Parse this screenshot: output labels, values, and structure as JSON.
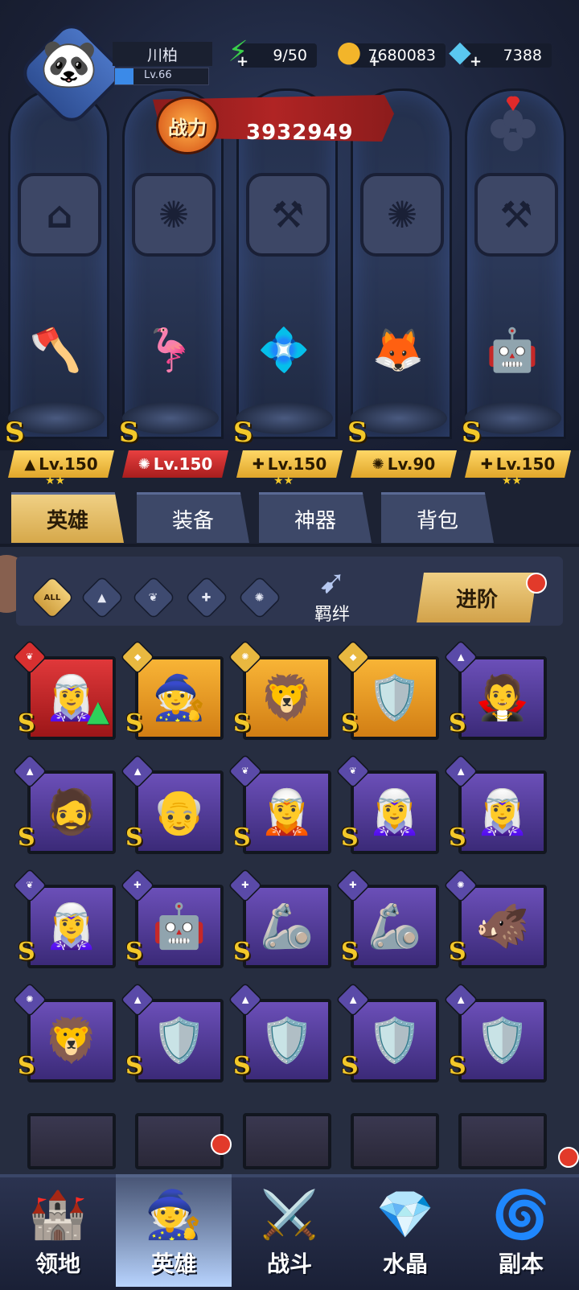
{
  "player": {
    "name": "川柏",
    "level": "Lv.66",
    "exp_fraction": 0.2
  },
  "resources": {
    "energy": {
      "icon": "lightning-icon",
      "value": "9/50"
    },
    "gold": {
      "icon": "gold-coin-icon",
      "value": "7680083"
    },
    "diamond": {
      "icon": "diamond-icon",
      "value": "7388"
    }
  },
  "power": {
    "label": "战力",
    "value": "3932949"
  },
  "team": [
    {
      "rank": "S",
      "class_icon": "mage-hat-icon",
      "level": "Lv.150",
      "stars": "★★",
      "plate": "gold",
      "figure": "🪓"
    },
    {
      "rank": "S",
      "class_icon": "beast-claw-icon",
      "level": "Lv.150",
      "stars": "",
      "plate": "red",
      "figure": "🦩"
    },
    {
      "rank": "S",
      "class_icon": "wrench-icon",
      "level": "Lv.150",
      "stars": "★★",
      "plate": "gold",
      "figure": "💠"
    },
    {
      "rank": "S",
      "class_icon": "beast-claw-icon",
      "level": "Lv.90",
      "stars": "",
      "plate": "gold",
      "figure": "🦊"
    },
    {
      "rank": "S",
      "class_icon": "wrench-icon",
      "level": "Lv.150",
      "stars": "★★",
      "plate": "gold",
      "figure": "🤖"
    }
  ],
  "emblems": [
    "⌂",
    "✺",
    "⚒",
    "✺",
    "⚒"
  ],
  "tabs": [
    "英雄",
    "装备",
    "神器",
    "背包"
  ],
  "filters": {
    "all_label": "ALL",
    "bond_label": "羁绊",
    "advance_label": "进阶"
  },
  "heroes": [
    {
      "frame": "red",
      "cls": "wing",
      "emoji": "🧝‍♀️",
      "up": true
    },
    {
      "frame": "orange",
      "cls": "gem",
      "emoji": "🧙"
    },
    {
      "frame": "orange",
      "cls": "claw",
      "emoji": "🦁"
    },
    {
      "frame": "orange",
      "cls": "gem",
      "emoji": "🛡️"
    },
    {
      "frame": "purple",
      "cls": "hat",
      "emoji": "🧛"
    },
    {
      "frame": "purple",
      "cls": "hat",
      "emoji": "🧔"
    },
    {
      "frame": "purple",
      "cls": "hat",
      "emoji": "👴"
    },
    {
      "frame": "purple",
      "cls": "wing",
      "emoji": "🧝"
    },
    {
      "frame": "purple",
      "cls": "wing",
      "emoji": "🧝‍♀️"
    },
    {
      "frame": "purple",
      "cls": "hat",
      "emoji": "🧝‍♀️"
    },
    {
      "frame": "purple",
      "cls": "wing",
      "emoji": "🧝‍♀️"
    },
    {
      "frame": "purple",
      "cls": "wrench",
      "emoji": "🤖"
    },
    {
      "frame": "purple",
      "cls": "wrench",
      "emoji": "🦾"
    },
    {
      "frame": "purple",
      "cls": "wrench",
      "emoji": "🦾"
    },
    {
      "frame": "purple",
      "cls": "claw",
      "emoji": "🐗"
    },
    {
      "frame": "purple",
      "cls": "claw",
      "emoji": "🦁"
    },
    {
      "frame": "purple",
      "cls": "hat",
      "emoji": "🛡️"
    },
    {
      "frame": "purple",
      "cls": "hat",
      "emoji": "🛡️"
    },
    {
      "frame": "purple",
      "cls": "hat",
      "emoji": "🛡️"
    },
    {
      "frame": "purple",
      "cls": "hat",
      "emoji": "🛡️"
    }
  ],
  "nav": [
    {
      "label": "领地",
      "icon": "castle-icon",
      "glyph": "🏰",
      "active": false,
      "dot": false
    },
    {
      "label": "英雄",
      "icon": "wizard-hat-icon",
      "glyph": "🧙",
      "active": true,
      "dot": true
    },
    {
      "label": "战斗",
      "icon": "battle-flag-icon",
      "glyph": "⚔️",
      "active": false,
      "dot": false
    },
    {
      "label": "水晶",
      "icon": "crystal-icon",
      "glyph": "💎",
      "active": false,
      "dot": false
    },
    {
      "label": "副本",
      "icon": "portal-icon",
      "glyph": "🌀",
      "active": false,
      "dot": true
    }
  ],
  "colors": {
    "gold": "#f3c82a",
    "accent_red": "#e23a2a",
    "panel": "#262d40"
  }
}
